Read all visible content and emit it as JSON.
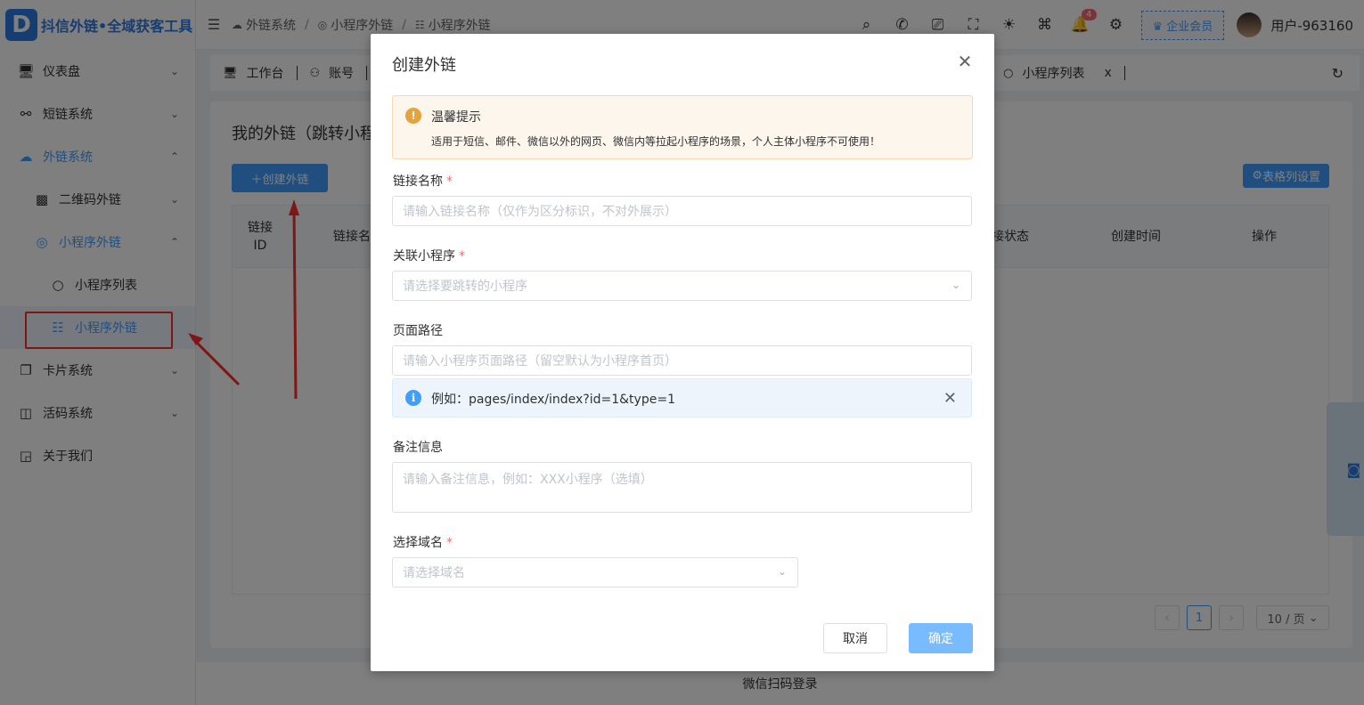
{
  "brand": {
    "logo_letter": "D",
    "name": "抖信外链•全域获客工具"
  },
  "sidebar": {
    "items": [
      {
        "label": "仪表盘",
        "icon": "monitor-icon",
        "arrow": "⌄"
      },
      {
        "label": "短链系统",
        "icon": "share-icon",
        "arrow": "⌄"
      },
      {
        "label": "外链系统",
        "icon": "cloud-icon",
        "arrow": "⌃"
      },
      {
        "label": "二维码外链",
        "icon": "qrcode-icon",
        "arrow": "⌄"
      },
      {
        "label": "小程序外链",
        "icon": "miniapp-icon",
        "arrow": "⌃"
      },
      {
        "label": "小程序列表",
        "icon": "circle-icon"
      },
      {
        "label": "小程序外链",
        "icon": "grid-list-icon"
      },
      {
        "label": "卡片系统",
        "icon": "cards-icon",
        "arrow": "⌄"
      },
      {
        "label": "活码系统",
        "icon": "code-icon",
        "arrow": "⌄"
      },
      {
        "label": "关于我们",
        "icon": "info-card-icon"
      }
    ]
  },
  "header": {
    "breadcrumb": [
      "外链系统",
      "小程序外链",
      "小程序外链"
    ],
    "notification_count": "4",
    "vip_label": "企业会员",
    "username": "用户-963160"
  },
  "tabs": [
    {
      "label": "工作台"
    },
    {
      "label": "账号"
    },
    {
      "label": "小程序列表",
      "close": "x"
    }
  ],
  "main": {
    "heading": "我的外链（跳转小程",
    "create_button": "创建外链",
    "column_settings_button": "表格列设置",
    "table_headers": [
      "链接\nID",
      "链接名称",
      "接状态",
      "创建时间",
      "操作"
    ],
    "pagination": {
      "current_page": "1",
      "page_size": "10 / 页"
    }
  },
  "footer": {
    "login_text": "微信扫码登录"
  },
  "dialog": {
    "title": "创建外链",
    "warning": {
      "title": "温馨提示",
      "text": "适用于短信、邮件、微信以外的网页、微信内等拉起小程序的场景，个人主体小程序不可使用！"
    },
    "fields": {
      "link_name": {
        "label": "链接名称",
        "required": "*",
        "placeholder": "请输入链接名称（仅作为区分标识，不对外展示）"
      },
      "miniapp": {
        "label": "关联小程序",
        "required": "*",
        "placeholder": "请选择要跳转的小程序"
      },
      "page_path": {
        "label": "页面路径",
        "placeholder": "请输入小程序页面路径（留空默认为小程序首页）"
      },
      "path_hint": "例如：pages/index/index?id=1&type=1",
      "remark": {
        "label": "备注信息",
        "placeholder": "请输入备注信息，例如：XXX小程序（选填）"
      },
      "domain": {
        "label": "选择域名",
        "required": "*",
        "placeholder": "请选择域名"
      }
    },
    "buttons": {
      "cancel": "取消",
      "confirm": "确定"
    }
  },
  "colors": {
    "primary": "#409eff",
    "warning": "#e6a23c",
    "danger": "#f56c6c",
    "annotation_red": "#ff2d2d"
  }
}
